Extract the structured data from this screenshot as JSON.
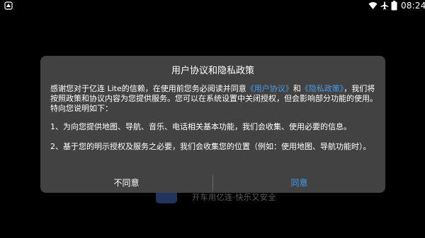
{
  "status_bar": {
    "time": "08:24",
    "icons": [
      "app-notification-icon",
      "wifi-icon",
      "airplane-mode-icon",
      "battery-icon"
    ]
  },
  "background": {
    "slogan": "开车用亿连·快乐又安全"
  },
  "dialog": {
    "title": "用户协议和隐私政策",
    "intro_part1": "感谢您对于亿连 Lite的信赖，在使用前您务必阅读并同意",
    "user_agreement_link": "《用户协议》",
    "and_text": "和",
    "privacy_policy_link": "《隐私政策》",
    "intro_part2": "，我们将按照政策和协议内容为您提供服务。您可以在系统设置中关闭授权，但会影响部分功能的使用。特向您说明如下：",
    "item1": "1、为向您提供地图、导航、音乐、电话相关基本功能，我们会收集、使用必要的信息。",
    "item2": "2、基于您的明示授权及服务之必要，我们会收集您的位置（例如：使用地图、导航功能时）。",
    "decline_label": "不同意",
    "agree_label": "同意"
  },
  "colors": {
    "dialog_bg": "#424242",
    "link": "#4a9be8",
    "text": "#ffffff"
  }
}
